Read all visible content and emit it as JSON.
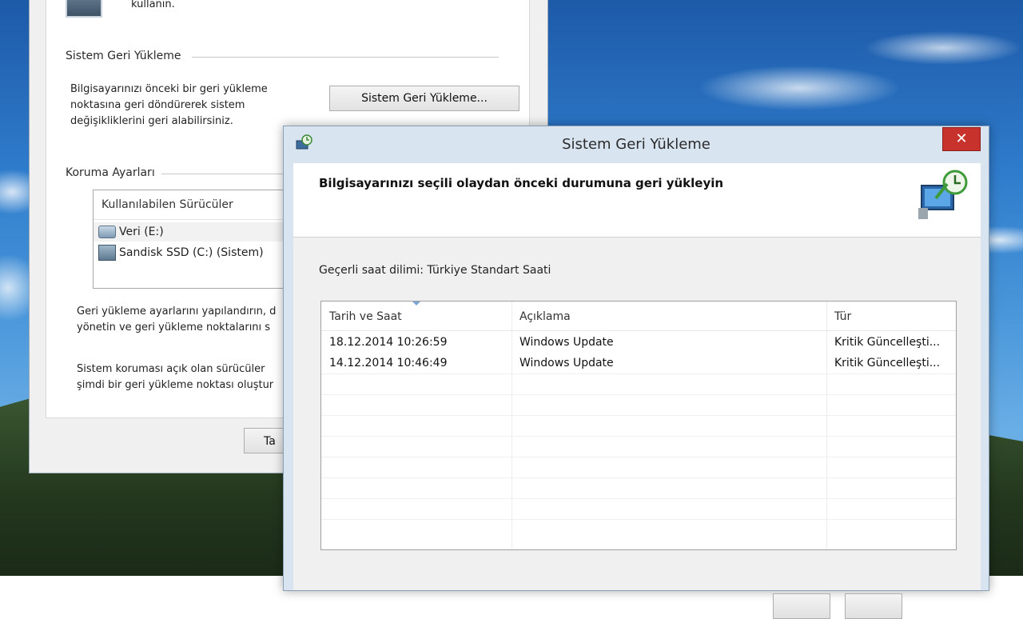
{
  "back_window": {
    "top_text": "kullanın.",
    "restore_group": {
      "title": "Sistem Geri Yükleme",
      "description": [
        "Bilgisayarınızı önceki bir geri yükleme",
        "noktasına geri döndürerek sistem",
        "değişikliklerini geri alabilirsiniz."
      ],
      "button_label": "Sistem Geri Yükleme..."
    },
    "protection_group": {
      "title": "Koruma Ayarları",
      "list_header": "Kullanılabilen Sürücüler",
      "drives": [
        {
          "label": "Veri (E:)",
          "icon": "hdd-icon"
        },
        {
          "label": "Sandisk SSD (C:) (Sistem)",
          "icon": "ssd-icon"
        }
      ],
      "config_text": [
        "Geri yükleme ayarlarını yapılandırın, d",
        "yönetin ve geri yükleme noktalarını s"
      ],
      "create_text": [
        "Sistem koruması açık olan sürücüler",
        "şimdi bir geri yükleme noktası oluştur"
      ],
      "partial_button_label": "Ta"
    }
  },
  "dialog": {
    "title": "Sistem Geri Yükleme",
    "close_label": "✕",
    "header_title": "Bilgisayarınızı seçili olaydan önceki durumuna geri yükleyin",
    "timezone_label": "Geçerli saat dilimi: Türkiye Standart Saati",
    "table": {
      "columns": [
        "Tarih ve Saat",
        "Açıklama",
        "Tür"
      ],
      "rows": [
        [
          "18.12.2014 10:26:59",
          "Windows Update",
          "Kritik Güncelleşti..."
        ],
        [
          "14.12.2014 10:46:49",
          "Windows Update",
          "Kritik Güncelleşti..."
        ]
      ]
    }
  },
  "colors": {
    "close_button": "#c7332c",
    "dialog_frame": "#d9e4f1"
  }
}
